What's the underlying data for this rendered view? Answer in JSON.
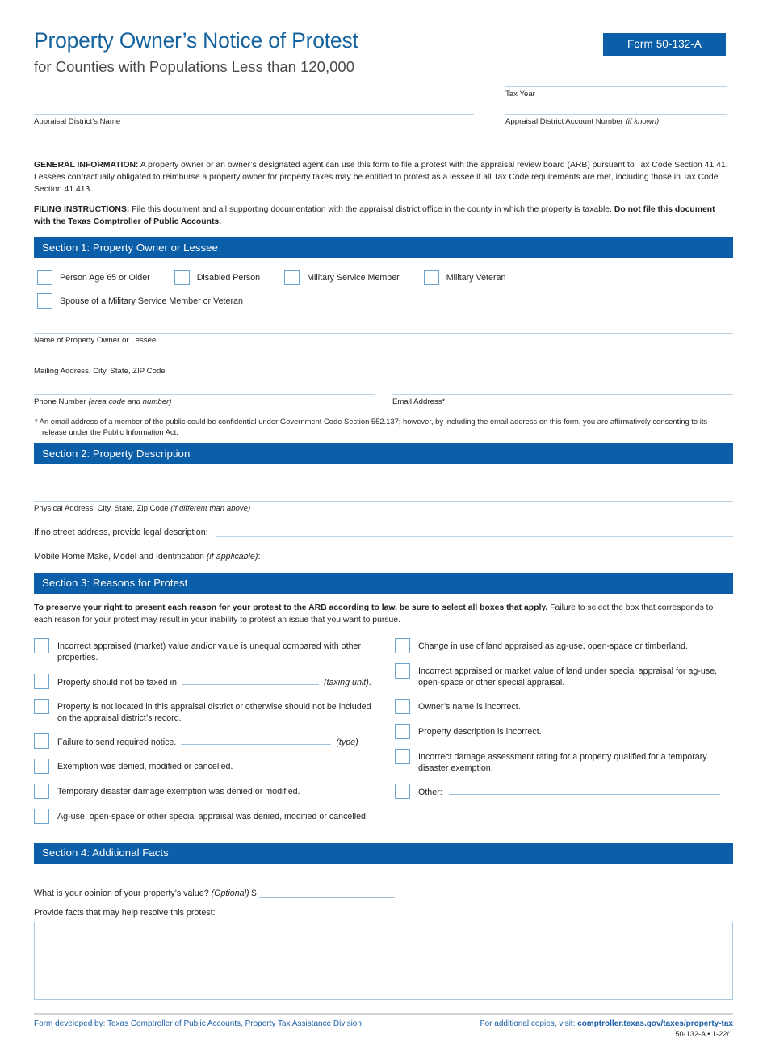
{
  "header": {
    "title": "Property Owner’s Notice of Protest",
    "subtitle": "for Counties with Populations Less than 120,000",
    "form_badge": "Form 50-132-A"
  },
  "top_fields": {
    "tax_year_label": "Tax Year",
    "district_name_label": "Appraisal District’s Name",
    "account_number_label": "Appraisal District Account Number ",
    "account_number_label_italic": "(if known)"
  },
  "info": {
    "general_label": "GENERAL INFORMATION:",
    "general_text": " A property owner or an owner’s designated agent can use this form to file a protest with the appraisal review board (ARB) pursuant to Tax Code Section 41.41. Lessees contractually obligated to reimburse a property owner for property taxes may be entitled to protest as a lessee if all Tax Code requirements are met, including those in Tax Code Section 41.413.",
    "filing_label": "FILING INSTRUCTIONS:",
    "filing_text": " File this document and all supporting documentation with the appraisal district office in the county in which the property is taxable. ",
    "filing_bold_tail": "Do not file this document with the Texas Comptroller of Public Accounts."
  },
  "section1": {
    "header": "Section 1: Property Owner or Lessee",
    "checkboxes": [
      {
        "label": "Person Age 65 or Older"
      },
      {
        "label": "Disabled Person"
      },
      {
        "label": "Military Service Member"
      },
      {
        "label": "Military Veteran"
      },
      {
        "label": "Spouse of a Military Service Member or Veteran"
      }
    ],
    "fields": {
      "name_label": "Name of Property Owner or Lessee",
      "mailing_label": "Mailing Address, City, State, ZIP Code",
      "phone_label": "Phone Number ",
      "phone_label_italic": "(area code and number)",
      "email_label": "Email Address*"
    },
    "footnote_line1": "* An email address of a member of the public could be confidential under Government Code Section 552.137; however, by including the email address on this form, you are affirmatively consenting to its",
    "footnote_line2": "release under the Public Information Act."
  },
  "section2": {
    "header": "Section 2: Property Description",
    "physical_label": "Physical Address, City, State, Zip Code ",
    "physical_label_italic": "(if different than above)",
    "legal_label": "If no street address, provide legal description:",
    "mobile_label": "Mobile Home Make, Model and Identification ",
    "mobile_label_italic": "(if applicable)",
    "mobile_label_tail": ":"
  },
  "section3": {
    "header": "Section 3: Reasons for Protest",
    "intro_bold": "To preserve your right to present each reason for your protest to the ARB according to law, be sure to select all boxes that apply.",
    "intro_text": " Failure to select the box that corresponds to each reason for your protest may result in your inability to protest an issue that you want to pursue.",
    "left_column": [
      {
        "text": "Incorrect appraised (market) value and/or value is unequal compared with other properties."
      },
      {
        "text_before": "Property should not be taxed in",
        "has_line": true,
        "text_after_italic": "(taxing unit)",
        "text_after": "."
      },
      {
        "text": "Property is not located in this appraisal district or otherwise should not be included on the appraisal district’s record."
      },
      {
        "text_before": "Failure to send required notice.",
        "has_line": true,
        "text_after_italic": "(type)",
        "text_after": ""
      },
      {
        "text": "Exemption was denied, modified or cancelled."
      },
      {
        "text": "Temporary disaster damage exemption was denied or modified."
      },
      {
        "text": "Ag-use, open-space or other special appraisal was denied, modified or cancelled."
      }
    ],
    "right_column": [
      {
        "text": "Change in use of land appraised as ag-use, open-space or timberland."
      },
      {
        "text": "Incorrect appraised or market value of land under special appraisal for ag-use, open-space or other special appraisal."
      },
      {
        "text": "Owner’s name is incorrect."
      },
      {
        "text": "Property description is incorrect."
      },
      {
        "text": "Incorrect damage assessment rating for a property qualified for a temporary disaster exemption."
      },
      {
        "text_before": "Other:",
        "has_line": true,
        "text_after_italic": "",
        "text_after": ""
      }
    ]
  },
  "section4": {
    "header": "Section 4: Additional Facts",
    "opinion_label": "What is your opinion of your property’s value? ",
    "opinion_label_italic": "(Optional)",
    "opinion_currency": " $",
    "facts_label": "Provide facts that may help resolve this protest:"
  },
  "footer": {
    "left": "Form developed by: Texas Comptroller of Public Accounts, Property Tax Assistance Division",
    "right_prefix": "For additional copies, visit: ",
    "right_url": "comptroller.texas.gov/taxes/property-tax",
    "code": "50-132-A • 1-22/1"
  },
  "colors": {
    "accent_blue": "#0b5ea8",
    "title_blue": "#14639e",
    "line_blue": "#bcd3e5",
    "checkbox_border": "#6ba4cf"
  }
}
